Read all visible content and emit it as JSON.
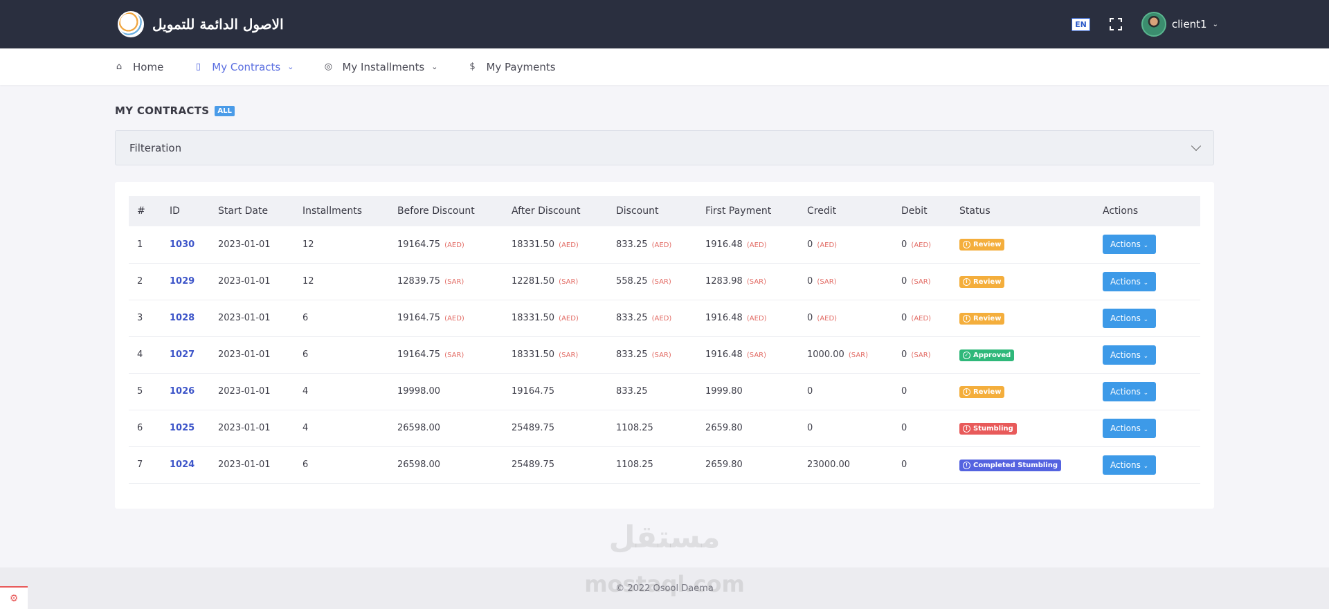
{
  "header": {
    "brand": "الاصول الدائمة للتمويل",
    "lang": "EN",
    "username": "client1"
  },
  "nav": {
    "items": [
      {
        "label": "Home",
        "icon": "home-icon",
        "active": false,
        "dropdown": false
      },
      {
        "label": "My Contracts",
        "icon": "document-icon",
        "active": true,
        "dropdown": true
      },
      {
        "label": "My Installments",
        "icon": "coin-icon",
        "active": false,
        "dropdown": true
      },
      {
        "label": "My Payments",
        "icon": "dollar-icon",
        "active": false,
        "dropdown": false
      }
    ]
  },
  "page": {
    "title": "MY CONTRACTS",
    "badge": "ALL",
    "filter_label": "Filteration"
  },
  "table": {
    "columns": [
      "#",
      "ID",
      "Start Date",
      "Installments",
      "Before Discount",
      "After Discount",
      "Discount",
      "First Payment",
      "Credit",
      "Debit",
      "Status",
      "Actions"
    ],
    "rows": [
      {
        "n": "1",
        "id": "1030",
        "start": "2023-01-01",
        "inst": "12",
        "before": "19164.75",
        "after": "18331.50",
        "discount": "833.25",
        "first": "1916.48",
        "credit": "0",
        "debit": "0",
        "cur": "(AED)",
        "status": "Review",
        "status_type": "review"
      },
      {
        "n": "2",
        "id": "1029",
        "start": "2023-01-01",
        "inst": "12",
        "before": "12839.75",
        "after": "12281.50",
        "discount": "558.25",
        "first": "1283.98",
        "credit": "0",
        "debit": "0",
        "cur": "(SAR)",
        "status": "Review",
        "status_type": "review"
      },
      {
        "n": "3",
        "id": "1028",
        "start": "2023-01-01",
        "inst": "6",
        "before": "19164.75",
        "after": "18331.50",
        "discount": "833.25",
        "first": "1916.48",
        "credit": "0",
        "debit": "0",
        "cur": "(AED)",
        "status": "Review",
        "status_type": "review"
      },
      {
        "n": "4",
        "id": "1027",
        "start": "2023-01-01",
        "inst": "6",
        "before": "19164.75",
        "after": "18331.50",
        "discount": "833.25",
        "first": "1916.48",
        "credit": "1000.00",
        "debit": "0",
        "cur": "(SAR)",
        "status": "Approved",
        "status_type": "approved"
      },
      {
        "n": "5",
        "id": "1026",
        "start": "2023-01-01",
        "inst": "4",
        "before": "19998.00",
        "after": "19164.75",
        "discount": "833.25",
        "first": "1999.80",
        "credit": "0",
        "debit": "0",
        "cur": "",
        "status": "Review",
        "status_type": "review"
      },
      {
        "n": "6",
        "id": "1025",
        "start": "2023-01-01",
        "inst": "4",
        "before": "26598.00",
        "after": "25489.75",
        "discount": "1108.25",
        "first": "2659.80",
        "credit": "0",
        "debit": "0",
        "cur": "",
        "status": "Stumbling",
        "status_type": "stumbling"
      },
      {
        "n": "7",
        "id": "1024",
        "start": "2023-01-01",
        "inst": "6",
        "before": "26598.00",
        "after": "25489.75",
        "discount": "1108.25",
        "first": "2659.80",
        "credit": "23000.00",
        "debit": "0",
        "cur": "",
        "status": "Completed Stumbling",
        "status_type": "completed"
      }
    ],
    "action_label": "Actions"
  },
  "footer": {
    "copyright": "© 2022 Osool Daema",
    "watermark_ar": "مستقل",
    "watermark_en": "mostaql.com"
  },
  "colors": {
    "topbar": "#2a2f3f",
    "accent": "#5a6ee0",
    "review": "#f4ae3c",
    "approved": "#2fb87a",
    "stumbling": "#e85a5a",
    "completed": "#5463e0",
    "currency": "#e26a63"
  }
}
